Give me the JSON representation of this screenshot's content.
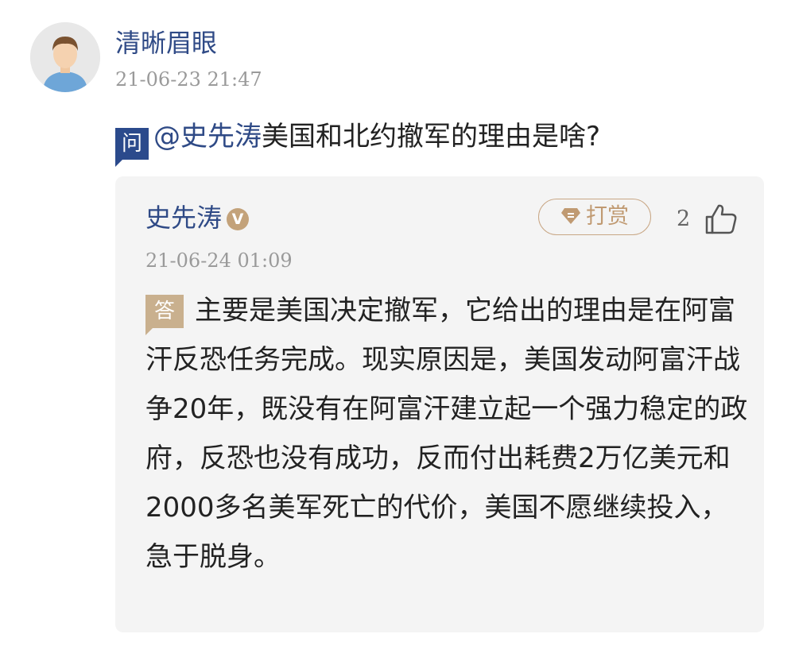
{
  "question_post": {
    "user": {
      "name": "清晰眉眼",
      "avatar": "default-avatar"
    },
    "timestamp": "21-06-23 21:47",
    "badge": "问",
    "mention": "@史先涛",
    "text": "美国和北约撤军的理由是啥?"
  },
  "answer_post": {
    "author": "史先涛",
    "verified_badge": "V",
    "reward_label": "打赏",
    "like_count": "2",
    "timestamp": "21-06-24 01:09",
    "badge": "答",
    "text": "主要是美国决定撤军，它给出的理由是在阿富汗反恐任务完成。现实原因是，美国发动阿富汗战争20年，既没有在阿富汗建立起一个强力稳定的政府，反恐也没有成功，反而付出耗费2万亿美元和2000多名美军死亡的代价，美国不愿继续投入，急于脱身。"
  },
  "colors": {
    "link_blue": "#2f4a86",
    "question_badge": "#2b4a8c",
    "answer_badge": "#c9b08e",
    "reward_gold": "#c09a72",
    "card_bg": "#f4f4f4"
  },
  "icons": {
    "verified": "verified-v-icon",
    "reward": "gem-icon",
    "like": "thumbs-up-icon"
  }
}
